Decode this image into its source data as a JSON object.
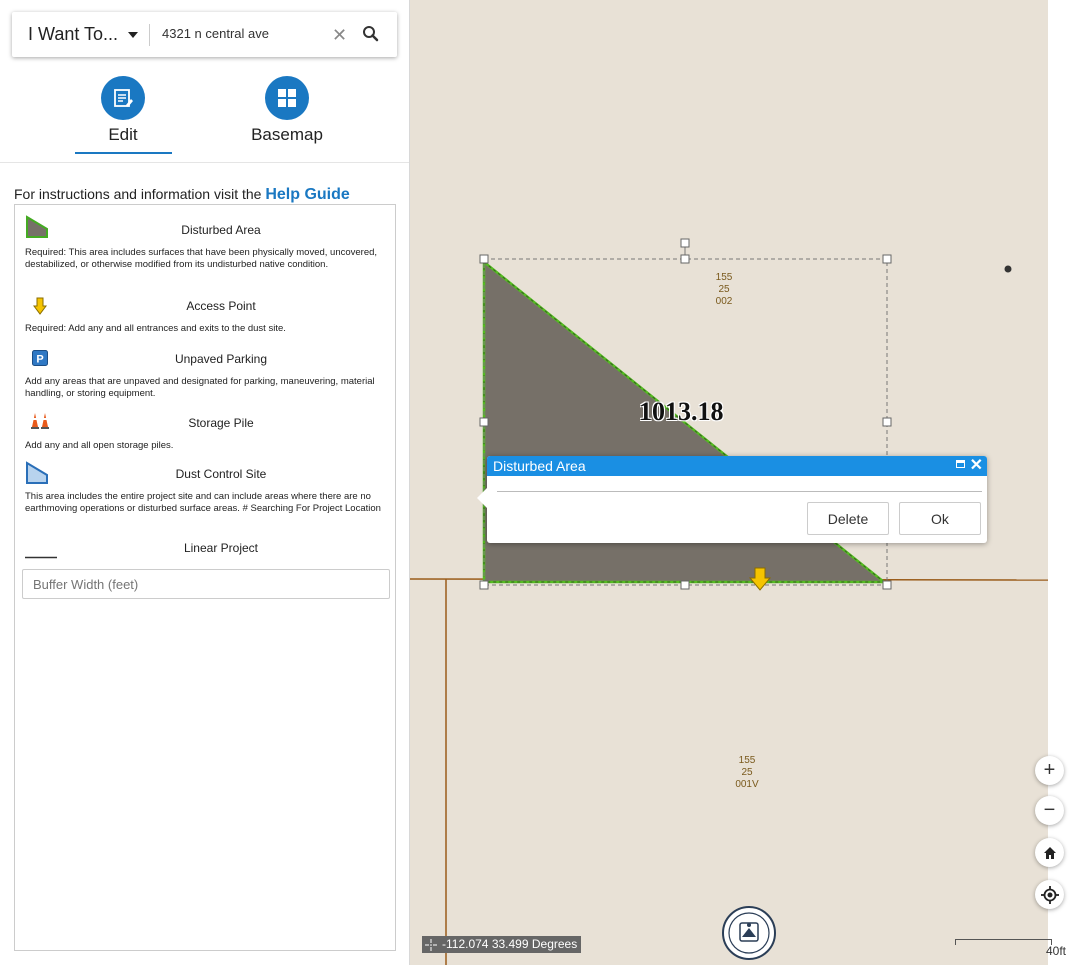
{
  "search": {
    "i_want_to": "I Want To...",
    "query": "4321 n central ave"
  },
  "tabs": {
    "edit": "Edit",
    "basemap": "Basemap"
  },
  "help": {
    "text": "For instructions and information visit the",
    "link": "Help Guide"
  },
  "templates": [
    {
      "name": "Disturbed Area",
      "icon": "polygon-green-icon",
      "description": "Required: This area includes surfaces that have been physically moved, uncovered, destabilized, or otherwise modified from its undisturbed native condition."
    },
    {
      "name": "Access Point",
      "icon": "yellow-arrow-icon",
      "description": "Required: Add any and all entrances and exits to the dust site."
    },
    {
      "name": "Unpaved Parking",
      "icon": "parking-icon",
      "description": "Add any areas that are unpaved and designated for parking, maneuvering, material handling, or storing equipment."
    },
    {
      "name": "Storage Pile",
      "icon": "traffic-cones-icon",
      "description": "Add any and all open storage piles."
    },
    {
      "name": "Dust Control Site",
      "icon": "polygon-blue-icon",
      "description": "This area includes the entire project site and can include areas where there are no earthmoving operations or disturbed surface areas. # Searching For Project Location"
    },
    {
      "name": "Linear Project",
      "icon": "line-icon",
      "description": ""
    }
  ],
  "buffer_placeholder": "Buffer Width (feet)",
  "map": {
    "parcel_top": [
      "155",
      "25",
      "002"
    ],
    "parcel_bottom": [
      "155",
      "25",
      "001V"
    ],
    "measurement": "1013.18",
    "coordinates": "-112.074 33.499 Degrees",
    "scale": "40ft",
    "colors": {
      "polygon_fill": "#767068",
      "polygon_stroke": "#55bb22",
      "parcel_line": "#9a5c1a",
      "popup_header": "#1a8fe3"
    }
  },
  "popup": {
    "title": "Disturbed Area",
    "delete_label": "Delete",
    "ok_label": "Ok"
  }
}
